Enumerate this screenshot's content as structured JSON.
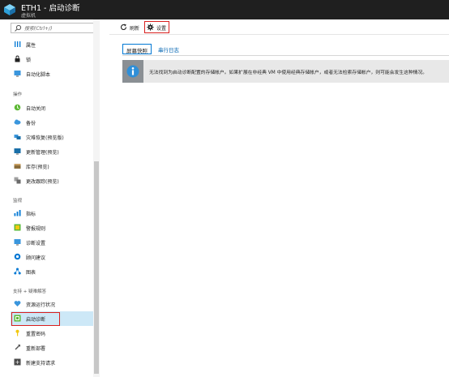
{
  "header": {
    "title": "ETH1 - 启动诊断",
    "subtitle": "虚拟机"
  },
  "sidebar": {
    "search_placeholder": "搜索(Ctrl+/)",
    "items": [
      {
        "label": "属性",
        "icon": "properties-icon"
      },
      {
        "label": "锁",
        "icon": "lock-icon"
      },
      {
        "label": "自动化脚本",
        "icon": "automation-script-icon"
      },
      {
        "label": "自动关闭",
        "icon": "auto-shutdown-icon"
      },
      {
        "label": "备份",
        "icon": "backup-icon"
      },
      {
        "label": "灾难恢复(预览版)",
        "icon": "disaster-recovery-icon"
      },
      {
        "label": "更新管理(预览)",
        "icon": "update-management-icon"
      },
      {
        "label": "库存(预览)",
        "icon": "inventory-icon"
      },
      {
        "label": "更改跟踪(预览)",
        "icon": "change-tracking-icon"
      },
      {
        "label": "指标",
        "icon": "metrics-icon"
      },
      {
        "label": "警报规则",
        "icon": "alert-rules-icon"
      },
      {
        "label": "诊断设置",
        "icon": "diagnostic-settings-icon"
      },
      {
        "label": "顾问建议",
        "icon": "advisor-icon"
      },
      {
        "label": "图表",
        "icon": "diagram-icon"
      },
      {
        "label": "资源运行状况",
        "icon": "resource-health-icon"
      },
      {
        "label": "启动诊断",
        "icon": "boot-diagnostics-icon"
      },
      {
        "label": "重置密码",
        "icon": "reset-password-icon"
      },
      {
        "label": "重新部署",
        "icon": "redeploy-icon"
      },
      {
        "label": "新建支持请求",
        "icon": "support-request-icon"
      }
    ],
    "sections": {
      "operations": "操作",
      "monitoring": "监视",
      "support": "支持 + 疑难解答"
    },
    "active_item": "启动诊断"
  },
  "toolbar": {
    "refresh_label": "刷新",
    "settings_label": "设置"
  },
  "tabs": {
    "screenshot": "屏幕快照",
    "serial_log": "串行日志"
  },
  "info": {
    "message": "无法找到为启动诊断配置的存储帐户。如果扩展在非经典 VM 中使用经典存储帐户，或者无法检索存储帐户，则可能会发生这种情况。"
  },
  "colors": {
    "header_bg": "#1f1f1f",
    "accent_blue": "#0078d4",
    "active_bg": "#cde8f7",
    "highlight_red": "#d9201f"
  }
}
